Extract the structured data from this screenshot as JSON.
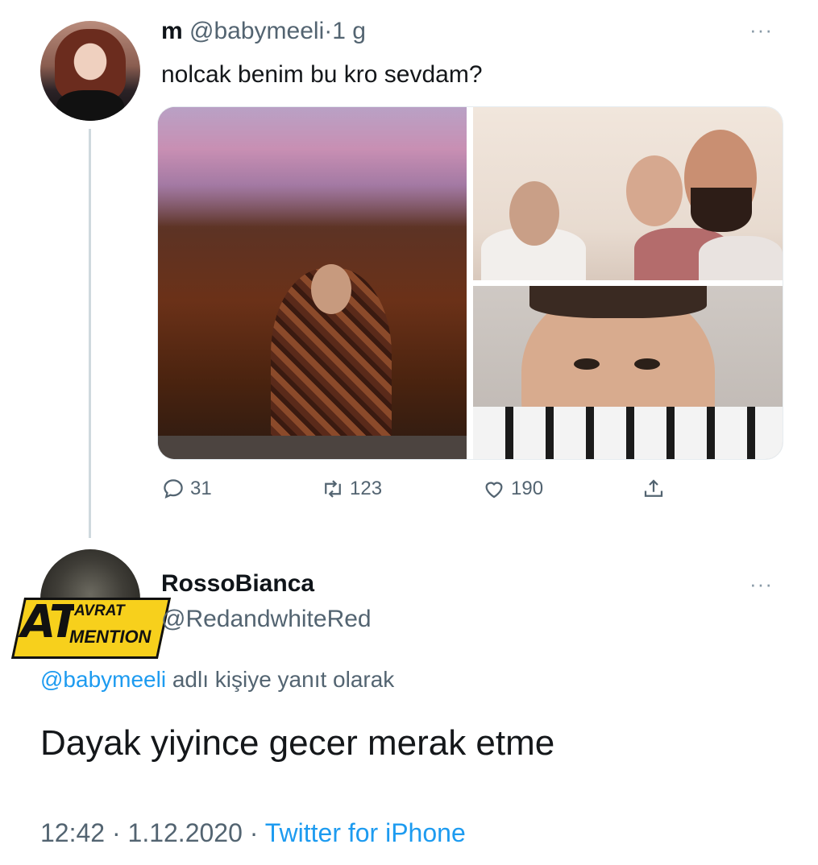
{
  "tweet": {
    "display_name": "m",
    "handle": "@babymeeli",
    "separator": "·",
    "time_ago": "1 g",
    "more": "···",
    "text": "nolcak benim bu kro sevdam?",
    "media_count": 3,
    "stats": {
      "replies": "31",
      "retweets": "123",
      "likes": "190"
    }
  },
  "reply": {
    "display_name": "RossoBianca",
    "handle": "@RedandwhiteRed",
    "more": "···",
    "avatar_badge": {
      "big": "AT",
      "top": "AVRAT",
      "bottom": "MENTION"
    },
    "replying_to_handle": "@babymeeli",
    "replying_to_suffix": "adlı kişiye yanıt olarak",
    "text": "Dayak yiyince gecer merak etme",
    "time": "12:42",
    "date": "1.12.2020",
    "separator": "·",
    "source": "Twitter for iPhone"
  },
  "icons": [
    "reply-icon",
    "retweet-icon",
    "like-icon",
    "share-icon",
    "more-icon"
  ],
  "colors": {
    "link": "#1d9bf0",
    "secondary_text": "#536471",
    "badge": "#f7d01c"
  }
}
